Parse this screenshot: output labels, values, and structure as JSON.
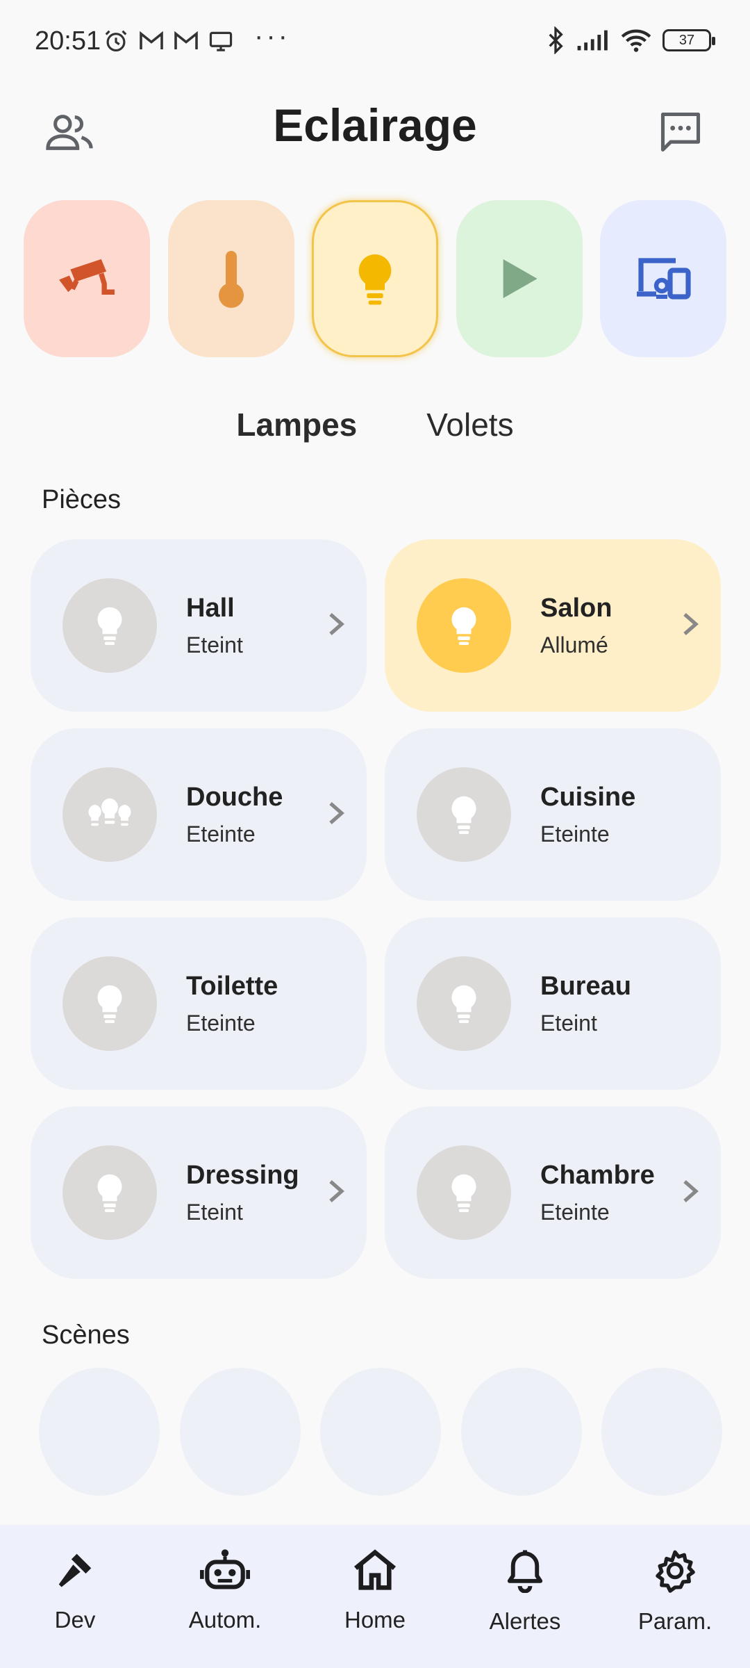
{
  "status_bar": {
    "time": "20:51",
    "battery": "37"
  },
  "header": {
    "title": "Eclairage"
  },
  "categories": [
    {
      "icon": "security-camera-icon",
      "color": "#d2542b",
      "bg": "#fdd9cf"
    },
    {
      "icon": "thermometer-icon",
      "color": "#e59540",
      "bg": "#fbe3cb"
    },
    {
      "icon": "lightbulb-icon",
      "color": "#f5b800",
      "bg": "#fff0c8",
      "selected": true
    },
    {
      "icon": "play-icon",
      "color": "#7fa987",
      "bg": "#dcf3dc"
    },
    {
      "icon": "devices-icon",
      "color": "#3b63c9",
      "bg": "#e6ecfd"
    }
  ],
  "tabs": {
    "lampes": "Lampes",
    "volets": "Volets",
    "active": "Lampes"
  },
  "sections": {
    "rooms": "Pièces",
    "scenes": "Scènes"
  },
  "rooms": [
    {
      "name": "Hall",
      "state": "Eteint",
      "on": false,
      "chevron": true
    },
    {
      "name": "Salon",
      "state": "Allumé",
      "on": true,
      "chevron": true
    },
    {
      "name": "Douche",
      "state": "Eteinte",
      "on": false,
      "chevron": true
    },
    {
      "name": "Cuisine",
      "state": "Eteinte",
      "on": false,
      "chevron": false
    },
    {
      "name": "Toilette",
      "state": "Eteinte",
      "on": false,
      "chevron": false
    },
    {
      "name": "Bureau",
      "state": "Eteint",
      "on": false,
      "chevron": false
    },
    {
      "name": "Dressing",
      "state": "Eteint",
      "on": false,
      "chevron": true
    },
    {
      "name": "Chambre",
      "state": "Eteinte",
      "on": false,
      "chevron": true
    }
  ],
  "scene_count_visible": 5,
  "bottom_nav": [
    {
      "label": "Dev",
      "icon": "hammer-icon"
    },
    {
      "label": "Autom.",
      "icon": "robot-icon"
    },
    {
      "label": "Home",
      "icon": "home-icon"
    },
    {
      "label": "Alertes",
      "icon": "bell-icon"
    },
    {
      "label": "Param.",
      "icon": "gear-icon"
    }
  ],
  "colors": {
    "background": "#f9f9f9",
    "card_off": "#edf0f6",
    "card_on": "#ffefc8",
    "bulb_off": "#dbdad9",
    "bulb_on": "#ffcc4f",
    "nav_bg": "#eef1fc"
  }
}
